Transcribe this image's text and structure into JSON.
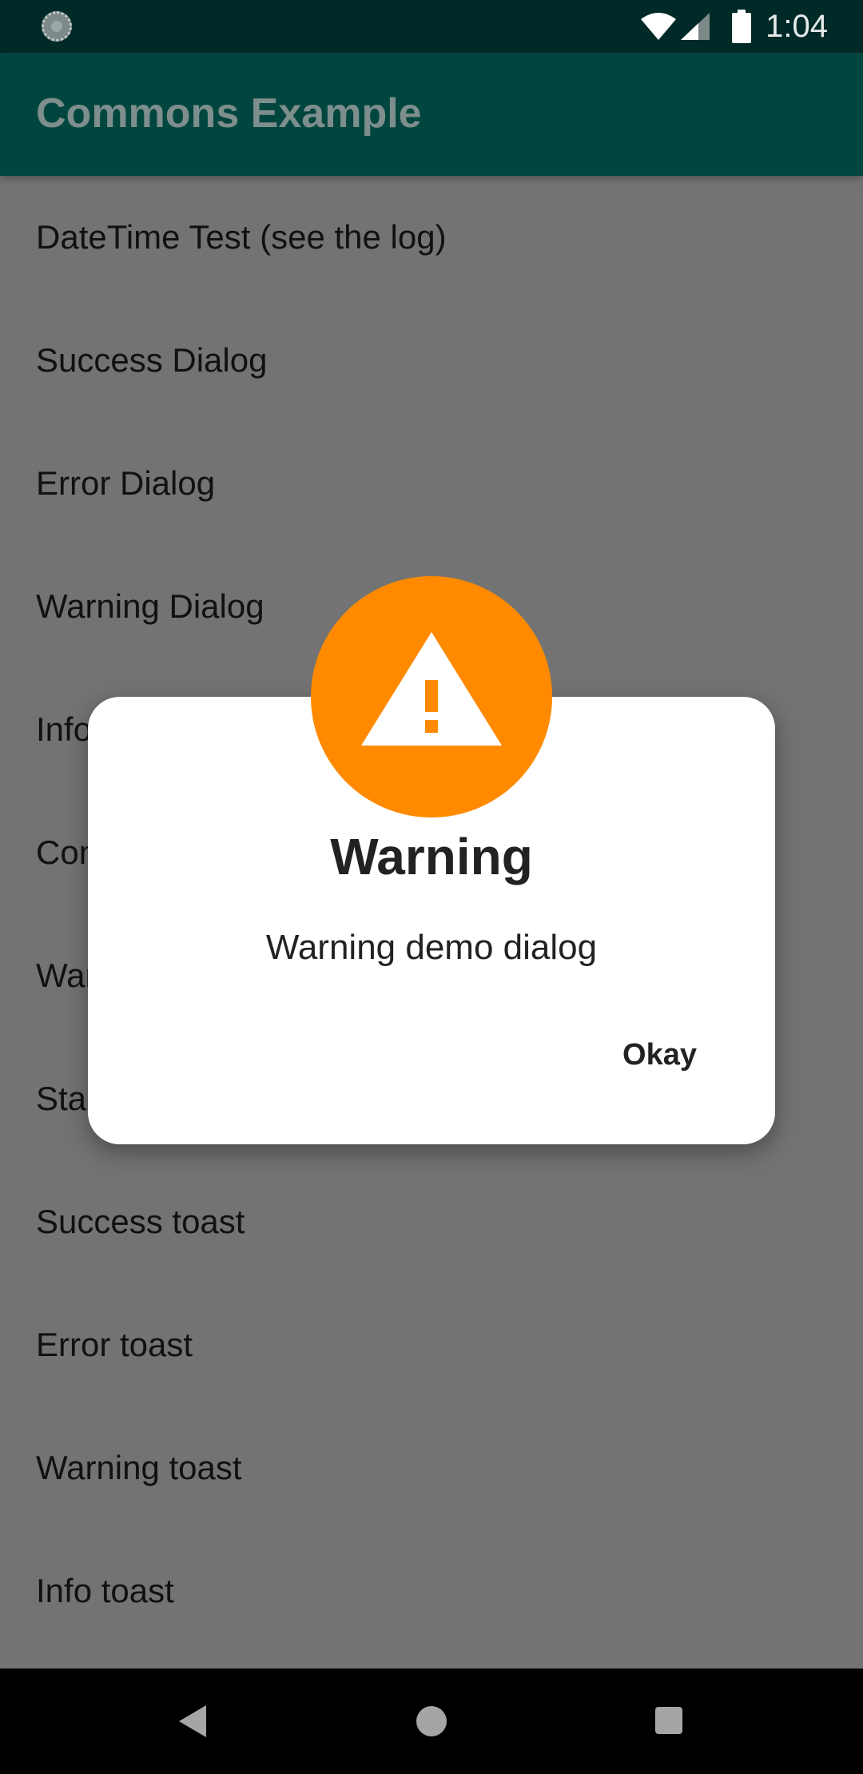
{
  "status_bar": {
    "time": "1:04",
    "icons": [
      "loading-spinner-icon",
      "wifi-icon",
      "cellular-signal-icon",
      "battery-icon"
    ]
  },
  "app_bar": {
    "title": "Commons Example"
  },
  "list": {
    "items": [
      "DateTime Test (see the log)",
      "Success Dialog",
      "Error Dialog",
      "Warning Dialog",
      "Info Dialog",
      "Confirm Dialog",
      "Warning Dialog",
      "Standard Dialog",
      "Success toast",
      "Error toast",
      "Warning toast",
      "Info toast"
    ]
  },
  "dialog": {
    "title": "Warning",
    "message": "Warning demo dialog",
    "okay_label": "Okay",
    "icon": "warning-icon",
    "accent_color": "#ff8a00"
  },
  "nav_bar": {
    "icons": [
      "back-icon",
      "home-icon",
      "recent-apps-icon"
    ]
  }
}
